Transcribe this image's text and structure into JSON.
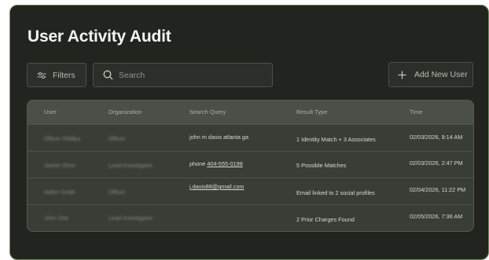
{
  "page": {
    "title": "User Activity Audit"
  },
  "toolbar": {
    "filters_label": "Filters",
    "search_placeholder": "Search",
    "add_user_label": "Add New User"
  },
  "icons": {
    "filters": "sliders-icon",
    "search": "search-icon",
    "add": "plus-icon"
  },
  "table": {
    "headers": [
      "User",
      "Organization",
      "Search Query",
      "Result Type",
      "Time"
    ],
    "rows": [
      {
        "user": "Officer Phillips",
        "organization": "Officer",
        "query_prefix": "john m davis atlanta ga",
        "query_link": "",
        "result_type": "1 Identity Match + 3 Associates",
        "time": "02/03/2026, 9:14 AM"
      },
      {
        "user": "Jackie Olver",
        "organization": "Lead Investigator",
        "query_prefix": "phone ",
        "query_link": "404-555-0198",
        "result_type": "5 Possible Matches",
        "time": "02/03/2026, 2:47 PM"
      },
      {
        "user": "Adam Smith",
        "organization": "Officer",
        "query_prefix": "",
        "query_link": "j.davis88@gmail.com",
        "result_type": "Email linked to 2 social profiles",
        "time": "02/04/2026, 11:22 PM"
      },
      {
        "user": "John Doe",
        "organization": "Lead Investigator",
        "query_prefix": "",
        "query_link": "",
        "result_type": "2 Prior Charges Found",
        "time": "02/05/2026, 7:36 AM"
      }
    ]
  }
}
